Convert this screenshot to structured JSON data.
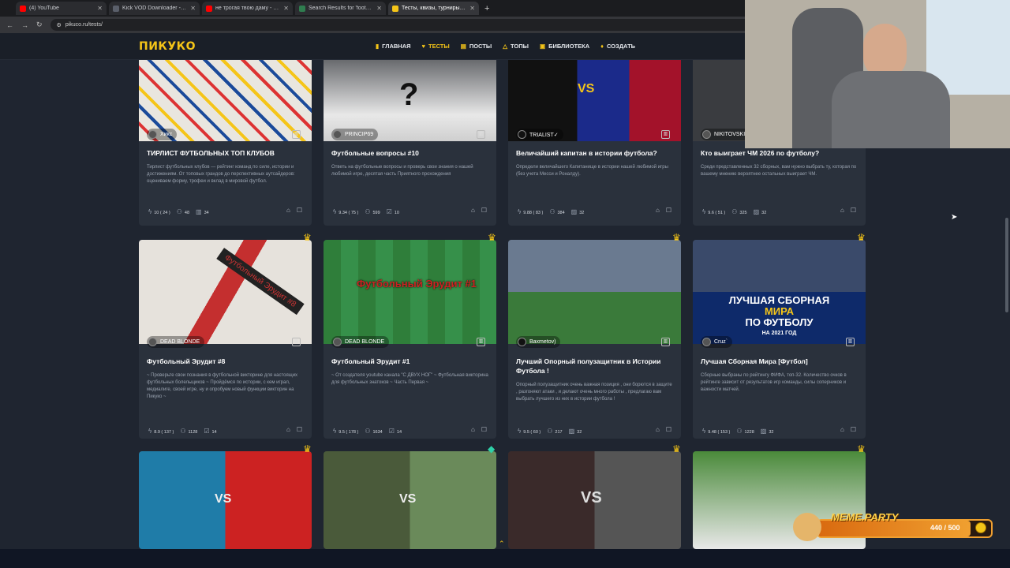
{
  "browser": {
    "tabs": [
      {
        "title": "(4) YouTube",
        "color": "#ff0000"
      },
      {
        "title": "Kick VOD Downloader - Stream",
        "color": "#5a5f6a"
      },
      {
        "title": "не трогая твою даму - YouTub",
        "color": "#ff0000"
      },
      {
        "title": "Search Results for 'football' - Ti",
        "color": "#2f7d4f"
      },
      {
        "title": "Тесты, квизы, турниры и тирл",
        "color": "#f5c518"
      }
    ],
    "url": "pikuco.ru/tests/"
  },
  "site": {
    "logo": "ПИКУКО",
    "nav": [
      {
        "label": "ГЛАВНАЯ",
        "icon": "bookmark-icon"
      },
      {
        "label": "ТЕСТЫ",
        "icon": "heart-icon"
      },
      {
        "label": "ПОСТЫ",
        "icon": "list-icon"
      },
      {
        "label": "ТОПЫ",
        "icon": "bell-icon"
      },
      {
        "label": "БИБЛИОТЕКА",
        "icon": "book-icon"
      },
      {
        "label": "СОЗДАТЬ",
        "icon": "bulb-icon"
      }
    ],
    "accent": "#f5c518"
  },
  "cards": [
    {
      "author": "Хикс",
      "title": "ТИРЛИСТ ФУТБОЛЬНЫХ ТОП КЛУБОВ",
      "desc": "Тирлист футбольных клубов — рейтинг команд по силе, истории и достижениям. От топовых грандов до перспективных аутсайдеров: оцениваем форму, трофеи и вклад в мировой футбол.",
      "rating": "10 ( 24 )",
      "plays": "48",
      "count": "34",
      "thumb": "#d8d4cc"
    },
    {
      "author": "PRINCIP69",
      "title": "Футбольные вопросы #10",
      "desc": "Ответь на футбольные вопросы и проверь свои знания о нашей любимой игре, десятая часть Приятного прохождения",
      "rating": "9.34 ( 75 )",
      "plays": "599",
      "count": "10",
      "thumb": "#3b3d42"
    },
    {
      "author": "TRIALIST✓",
      "title": "Величайший капитан в истории футбола?",
      "desc": "Определи величайшего Капитанище в истории нашей любимой игры (без учета Месси и Роналду).",
      "rating": "9.88 ( 83 )",
      "plays": "384",
      "count": "32",
      "thumb": "#1b2a55"
    },
    {
      "author": "NIKITOVSKI",
      "title": "Кто выиграет ЧМ 2026 по футболу?",
      "desc": "Среди представленных 32 сборных, вам нужно выбрать ту, которая по вашему мнению вероятнее остальных выиграет ЧМ.",
      "rating": "9.6 ( 51 )",
      "plays": "325",
      "count": "32",
      "thumb": "#3a3c40"
    },
    {
      "author": "DEAD BLONDE",
      "title": "Футбольный Эрудит #8",
      "desc": "~ Проверьте свои познания в футбольной викторине для настоящих футбольных болельщиков ~ Пройдёмся по истории, с кем играл, медиалиге, своей игре, ну и опробуем новый функции викторин на Пикуко ~",
      "rating": "8.9 ( 137 )",
      "plays": "1128",
      "count": "14",
      "thumb": "#c9b8a8"
    },
    {
      "author": "DEAD BLONDE",
      "title": "Футбольный Эрудит #1",
      "desc": "~ От создателя youtube канала \"С ДВУХ НОГ\" ~ Футбольная викторина для футбольных знатоков ~ Часть Первая ~",
      "rating": "9.5 ( 178 )",
      "plays": "1634",
      "count": "14",
      "thumb": "#2e7a3a"
    },
    {
      "author": "Baxmetov)",
      "title": "Лучший Опорный полузащитник в Истории Футбола !",
      "desc": "Опорный полузащитник очень важная позиция , они борются в защите , разгоняют атаки , и делают очень много работы , предлагаю вам выбрать лучшего из них в истории футбола !",
      "rating": "9.5 ( 60 )",
      "plays": "217",
      "count": "32",
      "thumb": "#5a7a9a"
    },
    {
      "author": "Cruz`",
      "title": "Лучшая Сборная Мира [Футбол]",
      "desc": "Сборные выбраны по рейтингу ФИФА, топ-32. Количество очков в рейтинге зависит от результатов игр команды, силы соперников и важности матчей.",
      "rating": "9.48 ( 153 )",
      "plays": "1228",
      "count": "32",
      "thumb": "#1a3a7a"
    },
    {
      "author": "",
      "title": "",
      "desc": "",
      "rating": "",
      "plays": "",
      "count": "",
      "thumb": "#2a6a8a"
    },
    {
      "author": "",
      "title": "",
      "desc": "",
      "rating": "",
      "plays": "",
      "count": "",
      "thumb": "#4a5a3a"
    },
    {
      "author": "",
      "title": "",
      "desc": "",
      "rating": "",
      "plays": "",
      "count": "",
      "thumb": "#3a2a2a"
    },
    {
      "author": "",
      "title": "",
      "desc": "",
      "rating": "",
      "plays": "",
      "count": "",
      "thumb": "#4a8a3a"
    }
  ],
  "thumb_texts": {
    "card5": "Футбольный Эрудит #8",
    "card6": "Футбольный Эрудит #1",
    "card8_line1": "ЛУЧШАЯ СБОРНАЯ",
    "card8_line2": "МИРА",
    "card8_line3": "ПО ФУТБОЛУ",
    "card8_line4": "НА 2021 ГОД",
    "vs": "VS"
  },
  "stream_overlay": {
    "title": "MEME.PARTY",
    "progress": "440 / 500",
    "progress_fraction": 0.88
  }
}
